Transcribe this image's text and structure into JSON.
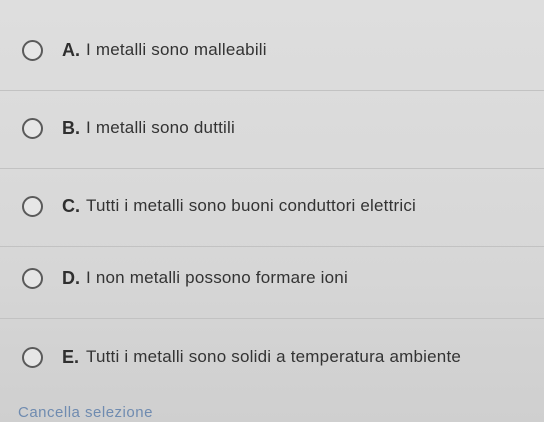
{
  "options": [
    {
      "letter": "A.",
      "text": "I metalli sono malleabili",
      "icon": "radio-empty-icon"
    },
    {
      "letter": "B.",
      "text": "I metalli sono duttili",
      "icon": "radio-empty-icon"
    },
    {
      "letter": "C.",
      "text": "Tutti i metalli sono buoni conduttori elettrici",
      "icon": "radio-empty-icon"
    },
    {
      "letter": "D.",
      "text": "I non metalli possono formare ioni",
      "icon": "radio-empty-icon"
    },
    {
      "letter": "E.",
      "text": "Tutti i metalli sono solidi a temperatura ambiente",
      "icon": "radio-empty-icon"
    }
  ],
  "clear_selection_label": "Cancella selezione",
  "colors": {
    "background": "#dadada",
    "text": "#333333",
    "link": "#6f8bb0",
    "radio_border": "#5a5a5a"
  }
}
